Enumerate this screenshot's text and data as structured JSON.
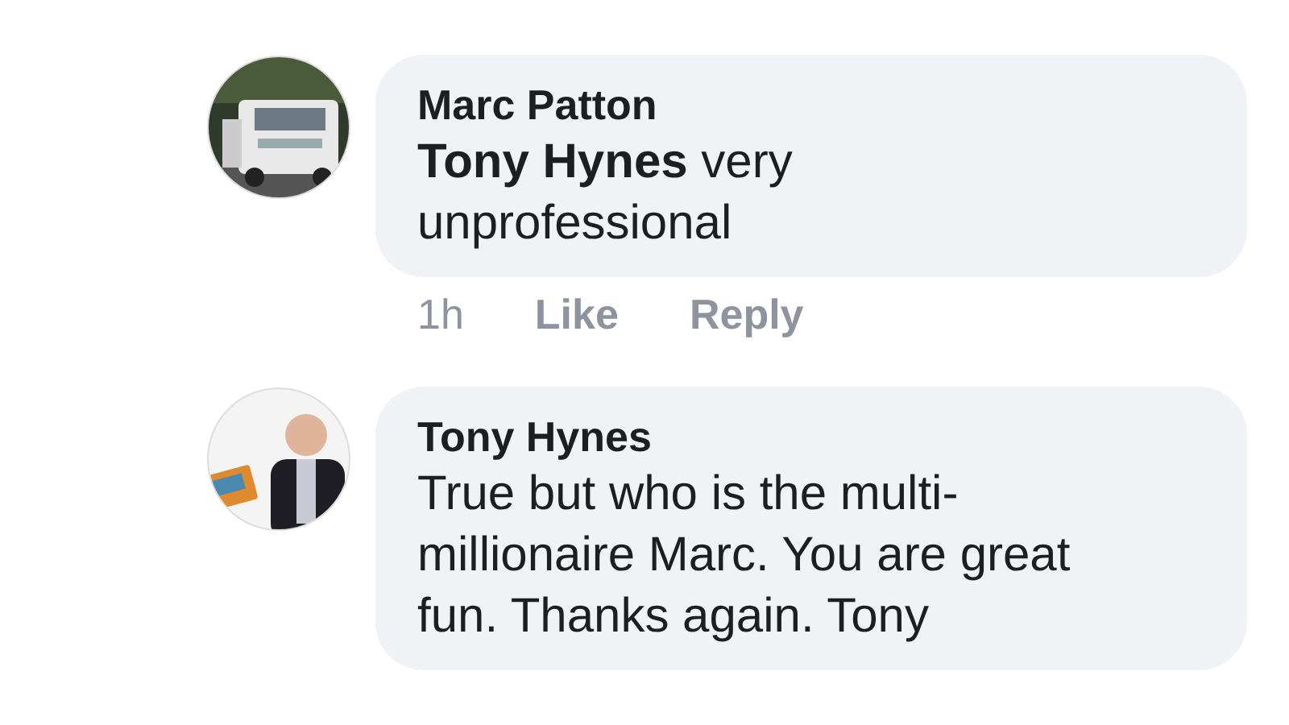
{
  "comments": [
    {
      "author": "Marc Patton",
      "text": "**Tony Hynes** very\nunprofessional",
      "meta": {
        "time": "1h",
        "actions": [
          "Like",
          "Reply"
        ]
      }
    },
    {
      "author": "Tony Hynes",
      "text": "True but who is the multi-\nmillionaire Marc. You are great\nfun. Thanks again. Tony"
    }
  ]
}
